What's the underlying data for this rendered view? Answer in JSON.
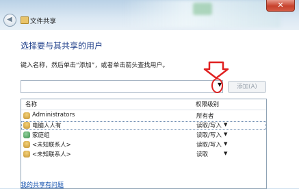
{
  "window": {
    "title": "文件共享"
  },
  "main": {
    "heading": "选择要与其共享的用户",
    "instruction": "键入名称，然后单击“添加”，或者单击箭头查找用户。",
    "name_input": {
      "value": "",
      "placeholder": ""
    },
    "add_button": "添加(A)"
  },
  "table": {
    "columns": [
      "名称",
      "权限级别"
    ],
    "rows": [
      {
        "name": "Administrators",
        "level": "所有者",
        "has_dropdown": false
      },
      {
        "name": "电脑人人有",
        "level": "读取/写入",
        "has_dropdown": true
      },
      {
        "name": "家庭组",
        "level": "读取/写入",
        "has_dropdown": true
      },
      {
        "name": "<未知联系人>",
        "level": "读取/写入",
        "has_dropdown": true
      },
      {
        "name": "<未知联系人>",
        "level": "读取",
        "has_dropdown": true
      }
    ]
  },
  "footer": {
    "help_link": "我的共享有问题"
  },
  "icons": {
    "back": "back-arrow-icon",
    "close": "close-icon",
    "title": "folder-share-icon",
    "user": "user-icon",
    "group": "homegroup-icon",
    "dropdown": "chevron-down-icon",
    "annotation": "red-down-arrow-icon"
  },
  "colors": {
    "heading": "#1f3f8a",
    "link": "#1a56b0",
    "annotation": "#e02020"
  }
}
